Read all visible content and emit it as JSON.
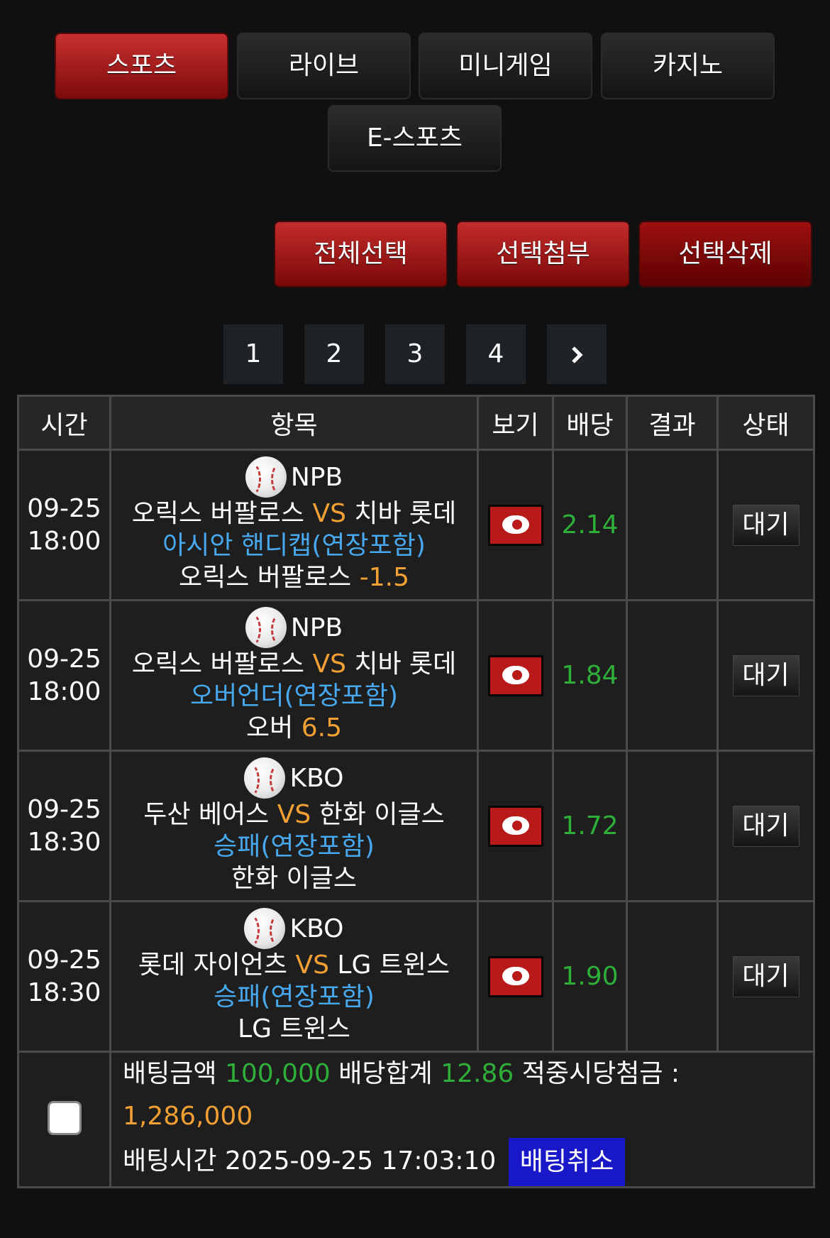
{
  "tabs": [
    {
      "label": "스포츠",
      "active": true
    },
    {
      "label": "라이브",
      "active": false
    },
    {
      "label": "미니게임",
      "active": false
    },
    {
      "label": "카지노",
      "active": false
    },
    {
      "label": "E-스포츠",
      "active": false
    }
  ],
  "actions": {
    "select_all": "전체선택",
    "attach_selected": "선택첨부",
    "delete_selected": "선택삭제"
  },
  "pagination": {
    "pages": [
      "1",
      "2",
      "3",
      "4"
    ],
    "next_icon": "chevron-right-icon"
  },
  "table": {
    "headers": [
      "시간",
      "항목",
      "보기",
      "배당",
      "결과",
      "상태"
    ],
    "rows": [
      {
        "date": "09-25",
        "time": "18:00",
        "league": "NPB",
        "icon": "baseball-icon",
        "home": "오릭스 버팔로스",
        "vs": "VS",
        "away": "치바 롯데",
        "market": "아시안 핸디캡(연장포함)",
        "pick": "오릭스 버팔로스",
        "pick_value": "-1.5",
        "odds": "2.14",
        "result": "",
        "status": "대기"
      },
      {
        "date": "09-25",
        "time": "18:00",
        "league": "NPB",
        "icon": "baseball-icon",
        "home": "오릭스 버팔로스",
        "vs": "VS",
        "away": "치바 롯데",
        "market": "오버언더(연장포함)",
        "pick": "오버",
        "pick_value": "6.5",
        "odds": "1.84",
        "result": "",
        "status": "대기"
      },
      {
        "date": "09-25",
        "time": "18:30",
        "league": "KBO",
        "icon": "baseball-icon",
        "home": "두산 베어스",
        "vs": "VS",
        "away": "한화 이글스",
        "market": "승패(연장포함)",
        "pick": "한화 이글스",
        "pick_value": "",
        "odds": "1.72",
        "result": "",
        "status": "대기"
      },
      {
        "date": "09-25",
        "time": "18:30",
        "league": "KBO",
        "icon": "baseball-icon",
        "home": "롯데 자이언츠",
        "vs": "VS",
        "away": "LG 트윈스",
        "market": "승패(연장포함)",
        "pick": "LG 트윈스",
        "pick_value": "",
        "odds": "1.90",
        "result": "",
        "status": "대기"
      }
    ]
  },
  "summary": {
    "bet_amount_label": "배팅금액",
    "bet_amount": "100,000",
    "odds_total_label": "배당합계",
    "odds_total": "12.86",
    "payout_label": "적중시당첨금 :",
    "payout": "1,286,000",
    "bet_time_label": "배팅시간",
    "bet_time": "2025-09-25 17:03:10",
    "cancel_label": "배팅취소"
  },
  "colors": {
    "background": "#101010",
    "accent_red": "#b81a1a",
    "odds_green": "#2fae3a",
    "highlight_orange": "#f2a033",
    "market_blue": "#48a8ee",
    "cancel_blue": "#1818c8"
  }
}
